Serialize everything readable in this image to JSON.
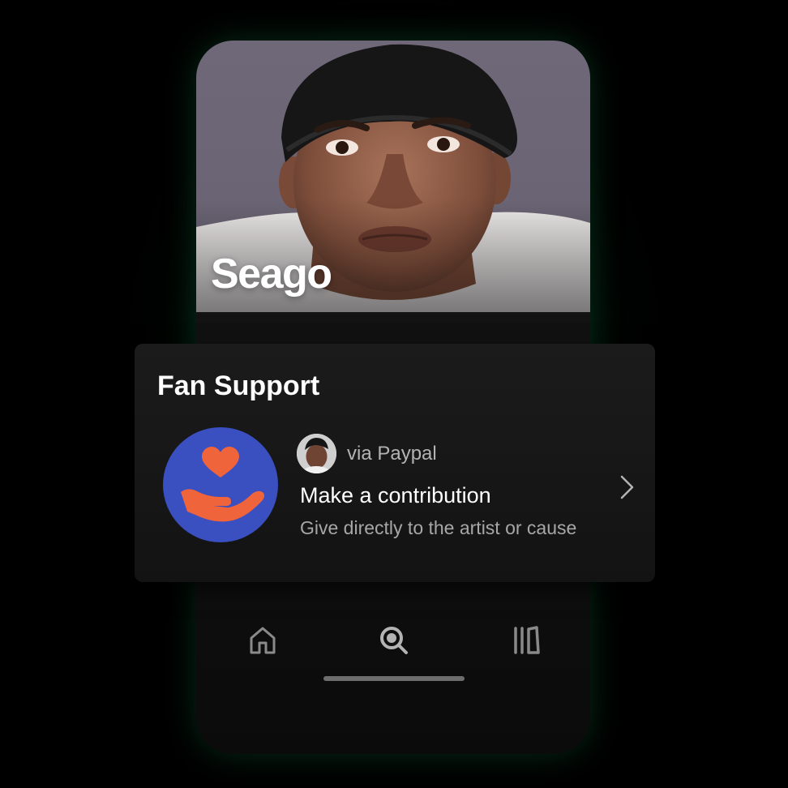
{
  "artist": {
    "name": "Seago"
  },
  "fan_support": {
    "title": "Fan Support",
    "item": {
      "via_label": "via Paypal",
      "title": "Make a contribution",
      "subtitle": "Give directly to the artist or cause"
    },
    "icon": "heart-hand-icon"
  },
  "nav": {
    "items": [
      {
        "icon": "home-icon"
      },
      {
        "icon": "search-icon"
      },
      {
        "icon": "library-icon"
      }
    ]
  },
  "colors": {
    "accent_green": "#1db954",
    "support_icon_bg": "#3a4fc0",
    "support_icon_fg": "#f0643c",
    "card_bg": "#161616"
  }
}
